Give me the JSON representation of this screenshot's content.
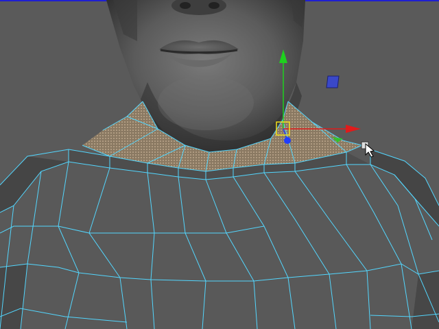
{
  "viewport": {
    "colors": {
      "background": "#5a5a5a",
      "frame_border": "#1f1fd1",
      "skin_dark": "#3a3a3a",
      "skin_mid": "#5c5c5c",
      "skin_light": "#7b7b7b",
      "body_fill": "#595959",
      "wire_cyan": "#53d7ff",
      "selection_fill": "#9a876e",
      "gizmo_red": "#e01b1b",
      "gizmo_green": "#1ed11e",
      "gizmo_blue": "#1f3dff",
      "gizmo_yellow": "#f2e21a"
    },
    "objects": {
      "head_mesh": "male-head",
      "torso_mesh": "shirt-torso-mesh",
      "selection": "neck-collar-faces",
      "manipulator": "move-tool-gizmo",
      "cursor": "arrow-cursor"
    }
  }
}
